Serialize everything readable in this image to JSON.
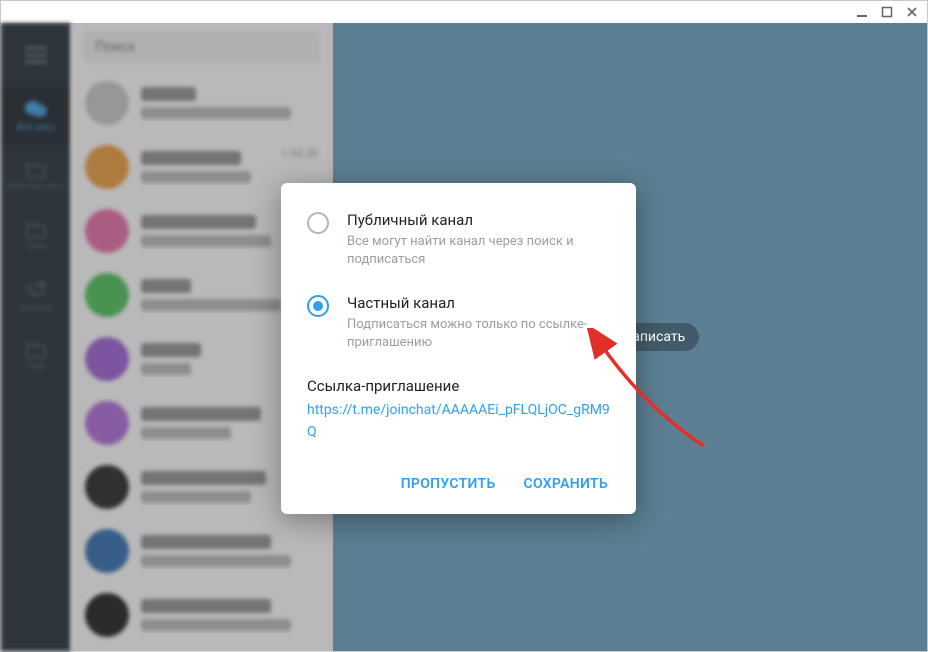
{
  "titlebar": {
    "min": "minimize",
    "max": "maximize",
    "close": "close"
  },
  "search": {
    "placeholder": "Поиск"
  },
  "rail": {
    "items": [
      {
        "label": "Все чаты"
      },
      {
        "label": "Рабочие чаты"
      },
      {
        "label": "Личн"
      },
      {
        "label": "Каналы"
      },
      {
        "label": "Ещё"
      }
    ]
  },
  "chatlist": {
    "date_sample": "1.04.20"
  },
  "main": {
    "empty_hint": "али бы написать"
  },
  "modal": {
    "options": [
      {
        "title": "Публичный канал",
        "desc": "Все могут найти канал через поиск и подписаться"
      },
      {
        "title": "Частный канал",
        "desc": "Подписаться можно только по ссылке-приглашению"
      }
    ],
    "invite_label": "Ссылка-приглашение",
    "invite_link": "https://t.me/joinchat/AAAAAEi_pFLQLjOC_gRM9Q",
    "skip": "ПРОПУСТИТЬ",
    "save": "СОХРАНИТЬ"
  }
}
